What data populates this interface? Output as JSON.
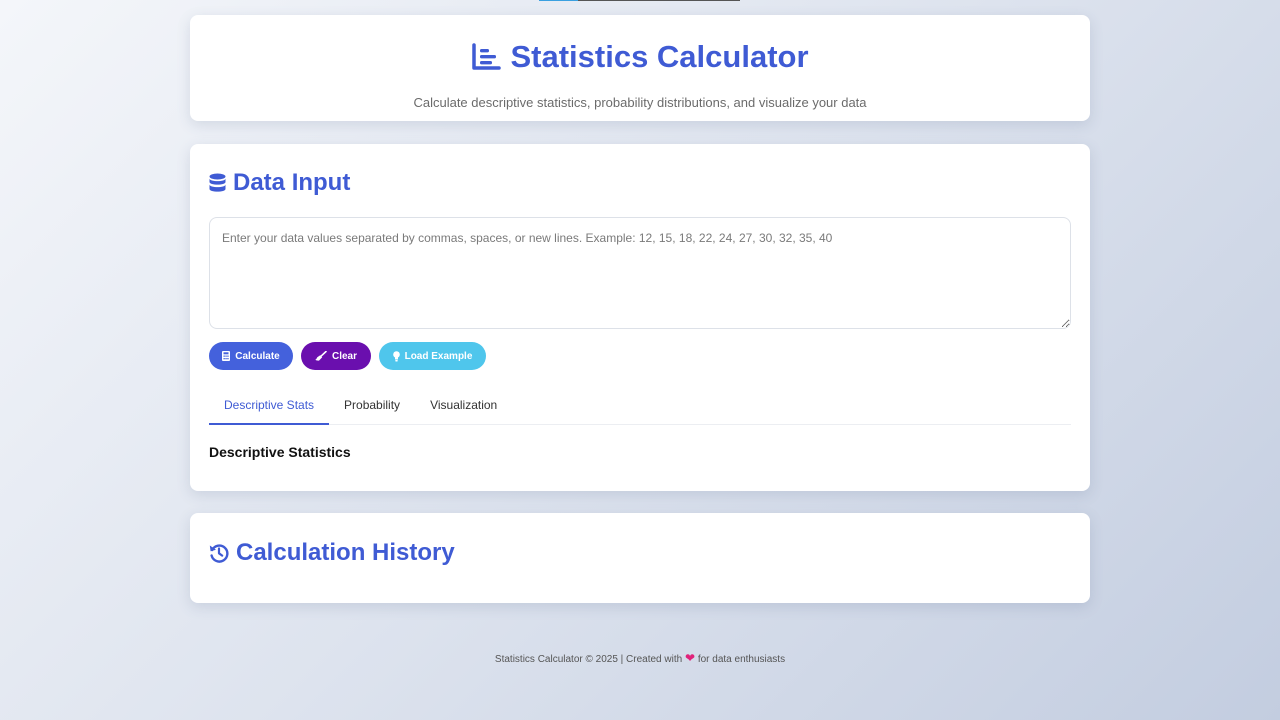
{
  "header": {
    "title": "Statistics Calculator",
    "subtitle": "Calculate descriptive statistics, probability distributions, and visualize your data",
    "icon": "chart-line-icon"
  },
  "input_section": {
    "title": "Data Input",
    "icon": "database-icon",
    "textarea": {
      "value": "",
      "placeholder": "Enter your data values separated by commas, spaces, or new lines. Example: 12, 15, 18, 22, 24, 27, 30, 32, 35, 40"
    },
    "buttons": [
      {
        "label": "Calculate",
        "icon": "calculator-icon",
        "color": "#4461dc"
      },
      {
        "label": "Clear",
        "icon": "broom-icon",
        "color": "#6a0fae"
      },
      {
        "label": "Load Example",
        "icon": "lightbulb-icon",
        "color": "#4fc6ec"
      }
    ],
    "tabs": [
      {
        "label": "Descriptive Stats",
        "active": true
      },
      {
        "label": "Probability",
        "active": false
      },
      {
        "label": "Visualization",
        "active": false
      }
    ],
    "active_tab_title": "Descriptive Statistics"
  },
  "history_section": {
    "title": "Calculation History",
    "icon": "history-icon"
  },
  "footer": {
    "text_before": "Statistics Calculator © 2025 | Created with",
    "heart": "❤",
    "text_after": "for data enthusiasts"
  },
  "colors": {
    "accent": "#3f5bd4",
    "heart": "#e0227a"
  }
}
